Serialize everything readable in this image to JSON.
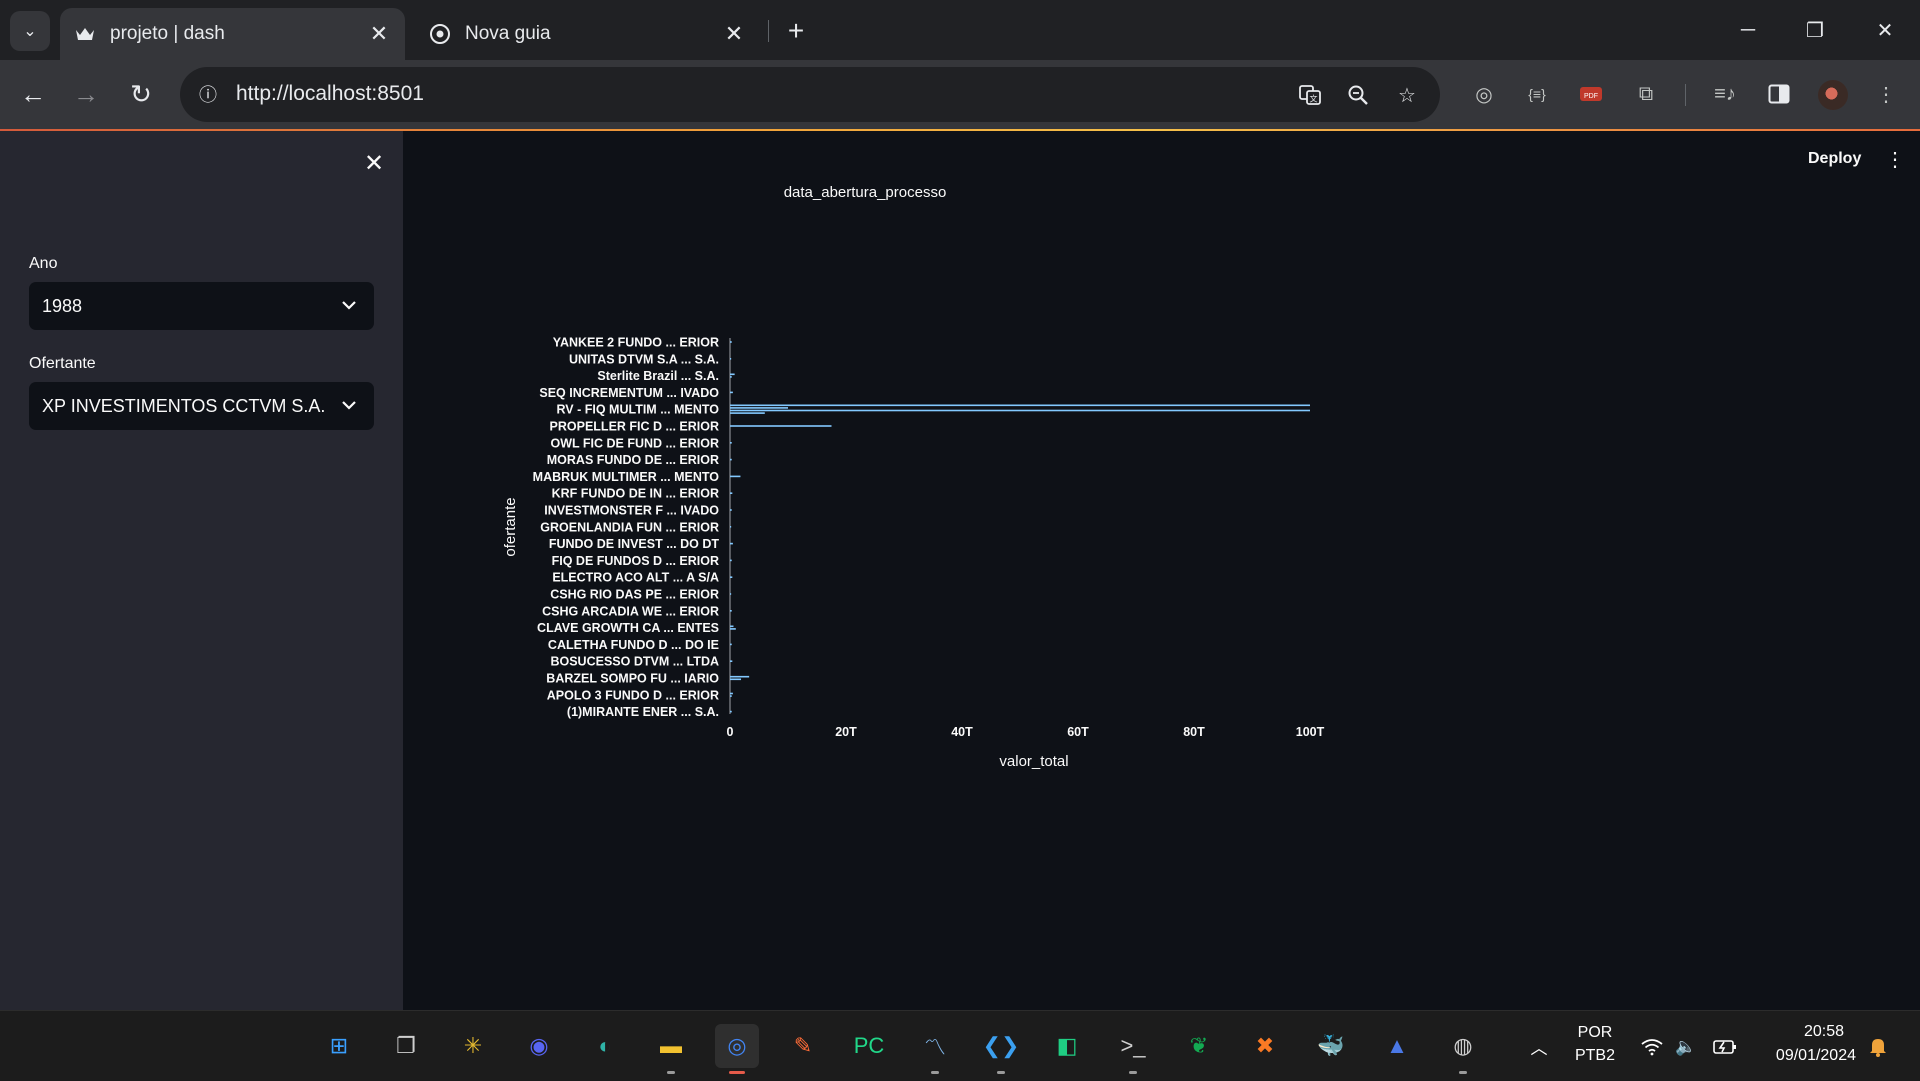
{
  "browser": {
    "tabs": [
      {
        "title": "projeto | dash",
        "favicon": "crown-icon",
        "active": true
      },
      {
        "title": "Nova guia",
        "favicon": "chrome-icon",
        "active": false
      }
    ],
    "url": "http://localhost:8501"
  },
  "sidebar": {
    "ano_label": "Ano",
    "ano_value": "1988",
    "ofertante_label": "Ofertante",
    "ofertante_value": "XP INVESTIMENTOS CCTVM S.A."
  },
  "header": {
    "deploy_label": "Deploy"
  },
  "chart_data": {
    "type": "bar",
    "orientation": "horizontal",
    "title": "data_abertura_processo",
    "xlabel": "valor_total",
    "ylabel": "ofertante",
    "xlim": [
      0,
      100
    ],
    "x_ticks": [
      "0",
      "20T",
      "40T",
      "60T",
      "80T",
      "100T"
    ],
    "x_tick_values": [
      0,
      20,
      40,
      60,
      80,
      100
    ],
    "bar_color": "#83c9ff",
    "categories": [
      "YANKEE 2 FUNDO  ... ERIOR",
      "UNITAS DTVM S.A ...  S.A.",
      "Sterlite Brazil ...  S.A.",
      "SEQ INCREMENTUM ... IVADO",
      "RV - FIQ MULTIM ... MENTO",
      "PROPELLER FIC D ... ERIOR",
      "OWL FIC DE FUND ... ERIOR",
      "MORAS FUNDO DE  ... ERIOR",
      "MABRUK MULTIMER ... MENTO",
      "KRF FUNDO DE IN ... ERIOR",
      "INVESTMONSTER F ... IVADO",
      "GROENLANDIA FUN ... ERIOR",
      "FUNDO DE INVEST ... DO DT",
      "FIQ DE FUNDOS D ... ERIOR",
      "ELECTRO ACO ALT ... A S/A",
      "CSHG RIO DAS PE ... ERIOR",
      "CSHG ARCADIA WE ... ERIOR",
      "CLAVE GROWTH CA ... ENTES",
      "CALETHA FUNDO D ... DO IE",
      "BOSUCESSO DTVM  ...  LTDA",
      "BARZEL SOMPO FU ... IARIO",
      "APOLO 3 FUNDO D ... ERIOR",
      "(1)MIRANTE ENER ...  S.A."
    ],
    "bars": [
      {
        "category": "YANKEE 2 FUNDO  ... ERIOR",
        "values": [
          0.3
        ]
      },
      {
        "category": "UNITAS DTVM S.A ...  S.A.",
        "values": [
          0.2
        ]
      },
      {
        "category": "Sterlite Brazil ...  S.A.",
        "values": [
          0.8,
          0.3
        ]
      },
      {
        "category": "SEQ INCREMENTUM ... IVADO",
        "values": [
          0.5
        ]
      },
      {
        "category": "RV - FIQ MULTIM ... MENTO",
        "values": [
          100,
          10,
          100,
          6
        ]
      },
      {
        "category": "PROPELLER FIC D ... ERIOR",
        "values": [
          17.5
        ]
      },
      {
        "category": "OWL FIC DE FUND ... ERIOR",
        "values": [
          0.3
        ]
      },
      {
        "category": "MORAS FUNDO DE  ... ERIOR",
        "values": [
          0.3
        ]
      },
      {
        "category": "MABRUK MULTIMER ... MENTO",
        "values": [
          1.8
        ]
      },
      {
        "category": "KRF FUNDO DE IN ... ERIOR",
        "values": [
          0.4
        ]
      },
      {
        "category": "INVESTMONSTER F ... IVADO",
        "values": [
          0.3
        ]
      },
      {
        "category": "GROENLANDIA FUN ... ERIOR",
        "values": [
          0.2
        ]
      },
      {
        "category": "FUNDO DE INVEST ... DO DT",
        "values": [
          0.5
        ]
      },
      {
        "category": "FIQ DE FUNDOS D ... ERIOR",
        "values": [
          0.3
        ]
      },
      {
        "category": "ELECTRO ACO ALT ... A S/A",
        "values": [
          0.4
        ]
      },
      {
        "category": "CSHG RIO DAS PE ... ERIOR",
        "values": [
          0.2
        ]
      },
      {
        "category": "CSHG ARCADIA WE ... ERIOR",
        "values": [
          0.3
        ]
      },
      {
        "category": "CLAVE GROWTH CA ... ENTES",
        "values": [
          0.6,
          1.0
        ]
      },
      {
        "category": "CALETHA FUNDO D ... DO IE",
        "values": [
          0.3
        ]
      },
      {
        "category": "BOSUCESSO DTVM  ...  LTDA",
        "values": [
          0.4
        ]
      },
      {
        "category": "BARZEL SOMPO FU ... IARIO",
        "values": [
          3.3,
          1.9
        ]
      },
      {
        "category": "APOLO 3 FUNDO D ... ERIOR",
        "values": [
          0.5,
          0.3
        ]
      },
      {
        "category": "(1)MIRANTE ENER ...  S.A.",
        "values": [
          0.3
        ]
      }
    ]
  },
  "taskbar": {
    "apps": [
      {
        "name": "windows-start-icon",
        "glyph": "⊞"
      },
      {
        "name": "task-view-icon",
        "glyph": "❐"
      },
      {
        "name": "slack-icon",
        "glyph": "✳"
      },
      {
        "name": "discord-icon",
        "glyph": "◉"
      },
      {
        "name": "edge-icon",
        "glyph": "◐"
      },
      {
        "name": "file-explorer-icon",
        "glyph": "▬"
      },
      {
        "name": "chrome-icon",
        "glyph": "◎"
      },
      {
        "name": "postman-icon",
        "glyph": "✎"
      },
      {
        "name": "pycharm-icon",
        "glyph": "PC"
      },
      {
        "name": "resource-monitor-icon",
        "glyph": "〽"
      },
      {
        "name": "vscode-icon",
        "glyph": "❮❯"
      },
      {
        "name": "green-app-icon",
        "glyph": "◧"
      },
      {
        "name": "terminal-icon",
        "glyph": ">_"
      },
      {
        "name": "mongodb-icon",
        "glyph": "❦"
      },
      {
        "name": "xampp-icon",
        "glyph": "✖"
      },
      {
        "name": "docker-icon",
        "glyph": "🐳"
      },
      {
        "name": "azure-data-studio-icon",
        "glyph": "▲"
      },
      {
        "name": "obs-icon",
        "glyph": "◍"
      }
    ],
    "lang_top": "POR",
    "lang_bottom": "PTB2",
    "time": "20:58",
    "date": "09/01/2024"
  }
}
